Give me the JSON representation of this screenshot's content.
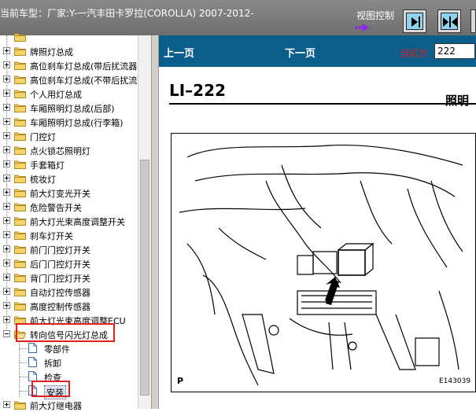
{
  "header": {
    "vehicle_title": "当前车型：厂家:Y-一汽丰田卡罗拉(COROLLA) 2007-2012-",
    "view_control_label": "视图控制",
    "buttons": [
      {
        "name": "view-next-button",
        "icon": "arrow-right-bar-icon"
      },
      {
        "name": "view-split-button",
        "icon": "split-arrows-icon"
      },
      {
        "name": "view-extra-button",
        "icon": "partial-button"
      }
    ]
  },
  "tree": {
    "items": [
      {
        "label": "牌照灯总成",
        "expanded": false
      },
      {
        "label": "高位刹车灯总成(带后扰流器",
        "expanded": false
      },
      {
        "label": "高位刹车灯总成(不带后扰流",
        "expanded": false
      },
      {
        "label": "个人用灯总成",
        "expanded": false
      },
      {
        "label": "车厢照明灯总成(后部)",
        "expanded": false
      },
      {
        "label": "车厢照明灯总成(行李箱)",
        "expanded": false
      },
      {
        "label": "门控灯",
        "expanded": false
      },
      {
        "label": "点火锁芯照明灯",
        "expanded": false
      },
      {
        "label": "手套箱灯",
        "expanded": false
      },
      {
        "label": "梳妆灯",
        "expanded": false
      },
      {
        "label": "前大灯变光开关",
        "expanded": false
      },
      {
        "label": "危险警告开关",
        "expanded": false
      },
      {
        "label": "前大灯光束高度调整开关",
        "expanded": false
      },
      {
        "label": "刹车灯开关",
        "expanded": false
      },
      {
        "label": "前门门控灯开关",
        "expanded": false
      },
      {
        "label": "后门门控灯开关",
        "expanded": false
      },
      {
        "label": "背门门控灯开关",
        "expanded": false
      },
      {
        "label": "自动灯控传感器",
        "expanded": false
      },
      {
        "label": "高度控制传感器",
        "expanded": false
      },
      {
        "label": "前大灯光束高度调整ECU",
        "expanded": false
      },
      {
        "label": "转向信号闪光灯总成",
        "expanded": true
      },
      {
        "label": "前大灯继电器",
        "expanded": false
      }
    ],
    "children": [
      "零部件",
      "拆卸",
      "检查",
      "安装"
    ]
  },
  "nav": {
    "prev": "上一页",
    "next": "下一页",
    "current_label": "当前为",
    "current_page": "222"
  },
  "document": {
    "page_code": "LI–222",
    "section_title": "照明",
    "diagram_label_p": "P",
    "diagram_code": "E143039"
  },
  "colors": {
    "nav_bar": "#0b5e8a",
    "highlight_red": "#e02020",
    "header_gray": "#7a7a7a",
    "button_blue": "#8fd3ef"
  }
}
